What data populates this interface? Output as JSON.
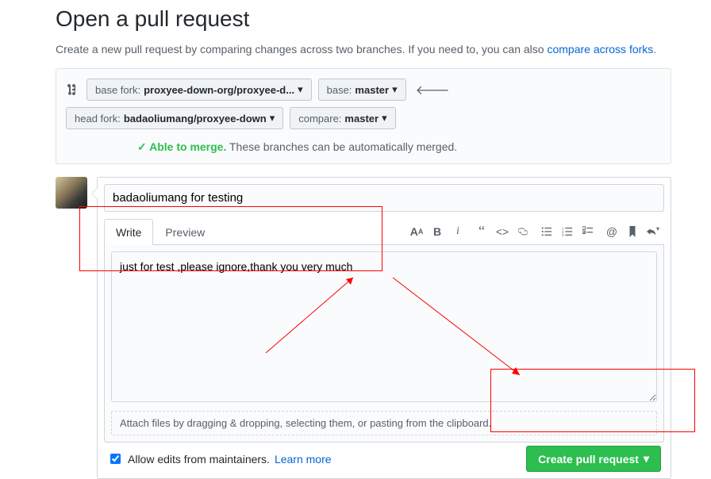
{
  "header": {
    "title": "Open a pull request",
    "subhead_text": "Create a new pull request by comparing changes across two branches. If you need to, you can also ",
    "compare_link": "compare across forks"
  },
  "range": {
    "base_fork_label": "base fork:",
    "base_fork_value": "proxyee-down-org/proxyee-d...",
    "base_branch_label": "base:",
    "base_branch_value": "master",
    "head_fork_label": "head fork:",
    "head_fork_value": "badaoliumang/proxyee-down",
    "compare_branch_label": "compare:",
    "compare_branch_value": "master",
    "merge_ok": "Able to merge.",
    "merge_msg": "These branches can be automatically merged."
  },
  "pr": {
    "title_value": "badaoliumang for testing",
    "body_value": "just for test ,please ignore,thank you very much",
    "attach_hint": "Attach files by dragging & dropping, selecting them, or pasting from the clipboard.",
    "allow_edits_label": "Allow edits from maintainers.",
    "learn_more": "Learn more",
    "submit_label": "Create pull request"
  },
  "tabs": {
    "write": "Write",
    "preview": "Preview"
  }
}
